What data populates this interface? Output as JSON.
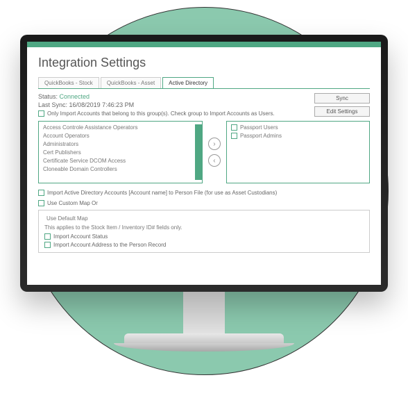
{
  "title": "Integration Settings",
  "tabs": {
    "stock": "QuickBooks - Stock",
    "asset": "QuickBooks - Asset",
    "ad": "Active Directory"
  },
  "status": {
    "label": "Status:",
    "value": "Connected",
    "last_sync_label": "Last Sync:",
    "last_sync_value": "16/08/2019 7:46:23 PM"
  },
  "buttons": {
    "sync": "Sync",
    "edit_settings": "Edit Settings"
  },
  "checks": {
    "only_import": "Only Import Accounts that belong to this group(s). Check group to Import Accounts as Users.",
    "import_ad_accounts": "Import Active Directory Accounts [Account name] to Person File (for use as Asset Custodians)",
    "use_custom_map": "Use Custom Map Or",
    "import_account_status": "Import Account Status",
    "import_account_address": "Import Account Address to the Person Record"
  },
  "left_list": {
    "i0": "Access Controle Assistance Operators",
    "i1": "Account Operators",
    "i2": "Administrators",
    "i3": "Cert Publishers",
    "i4": "Certificate Service DCOM Access",
    "i5": "Cloneable Domain Controllers"
  },
  "right_list": {
    "i0": "Passport Users",
    "i1": "Passport Admins"
  },
  "fieldset": {
    "legend": "Use Default Map",
    "note": "This applies to the Stock Item / Inventory ID# fields only."
  },
  "icons": {
    "right_arrow": "›",
    "left_arrow": "‹"
  }
}
